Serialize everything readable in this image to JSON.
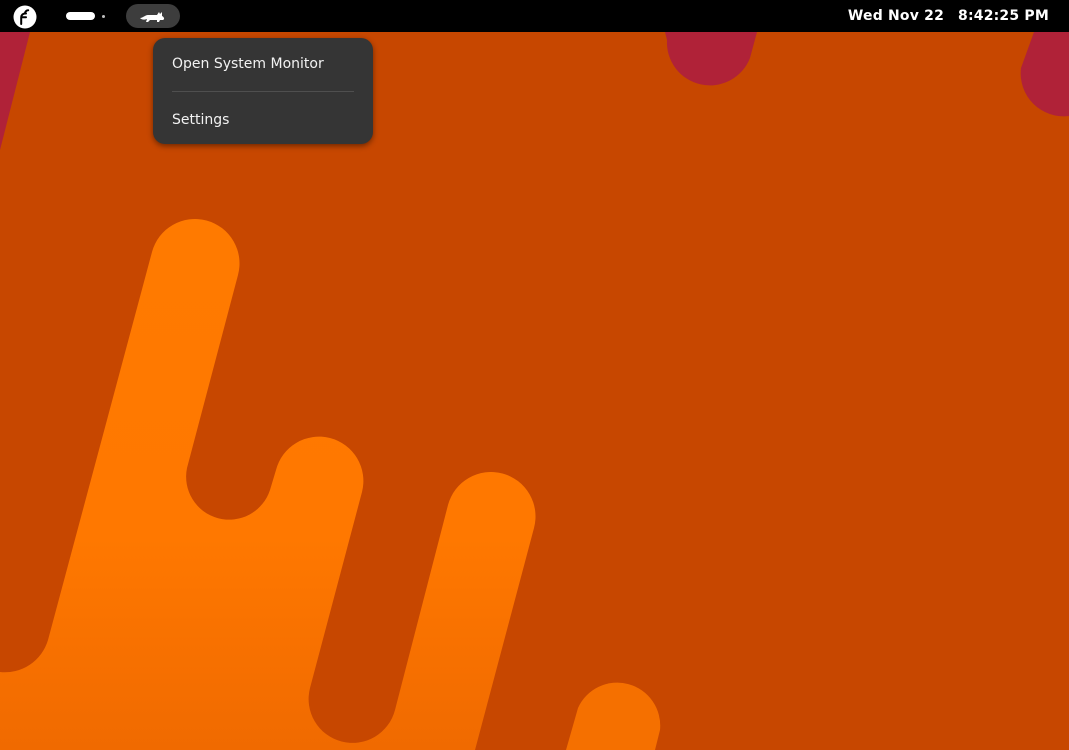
{
  "topbar": {
    "activities_icon": "fedora-logo-icon",
    "app_indicator_icon": "cat-icon",
    "date": "Wed Nov 22",
    "time": "8:42:25 PM"
  },
  "app_menu": {
    "items": [
      {
        "label": "Open System Monitor"
      },
      {
        "label": "Settings"
      }
    ]
  },
  "colors": {
    "wallpaper_base": "#c74700",
    "wallpaper_orange": "#ff7a00",
    "wallpaper_red": "#b02238",
    "topbar": "#000000",
    "menu_bg": "#353535"
  }
}
